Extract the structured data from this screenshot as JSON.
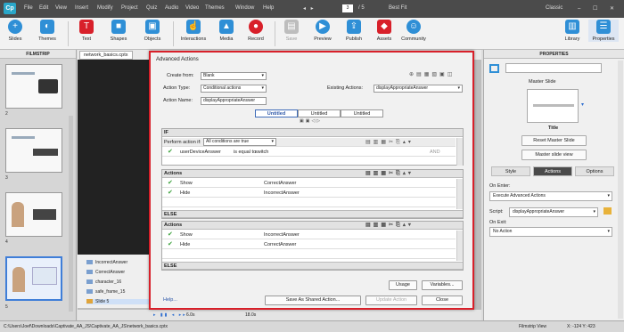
{
  "app": {
    "logo": "Cp",
    "menus": [
      "File",
      "Edit",
      "View",
      "Insert",
      "Modify",
      "Project",
      "Quiz",
      "Audio",
      "Video",
      "Themes",
      "Window",
      "Help"
    ],
    "page_current": "3",
    "page_total": "/ 5",
    "zoom": "Best Fit",
    "workspace": "Classic"
  },
  "toolbar": {
    "items": [
      {
        "label": "Slides",
        "icon": "slides-icon",
        "glyph": "+",
        "color": "#2f8fd6"
      },
      {
        "label": "Themes",
        "icon": "themes-icon",
        "glyph": "◐",
        "color": "#2f8fd6"
      },
      {
        "label": "Text",
        "icon": "text-icon",
        "glyph": "T",
        "color": "#d8202a"
      },
      {
        "label": "Shapes",
        "icon": "shapes-icon",
        "glyph": "■",
        "color": "#2f8fd6"
      },
      {
        "label": "Objects",
        "icon": "objects-icon",
        "glyph": "▣",
        "color": "#2f8fd6"
      },
      {
        "label": "Interactions",
        "icon": "interactions-icon",
        "glyph": "☝",
        "color": "#2f8fd6"
      },
      {
        "label": "Media",
        "icon": "media-icon",
        "glyph": "▲",
        "color": "#2f8fd6"
      },
      {
        "label": "Record",
        "icon": "microphone-icon",
        "glyph": "●",
        "color": "#d8202a"
      },
      {
        "label": "Save",
        "icon": "save-icon",
        "glyph": "▤",
        "color": "#bdbdbd"
      },
      {
        "label": "Preview",
        "icon": "preview-icon",
        "glyph": "▶",
        "color": "#2f8fd6"
      },
      {
        "label": "Publish",
        "icon": "publish-icon",
        "glyph": "⇪",
        "color": "#2f8fd6"
      },
      {
        "label": "Assets",
        "icon": "assets-icon",
        "glyph": "◆",
        "color": "#d8202a"
      },
      {
        "label": "Community",
        "icon": "community-icon",
        "glyph": "☺",
        "color": "#2f8fd6"
      }
    ],
    "right": [
      {
        "label": "Library",
        "icon": "library-icon",
        "glyph": "▥",
        "color": "#2f8fd6"
      },
      {
        "label": "Properties",
        "icon": "properties-icon",
        "glyph": "☰",
        "color": "#2f8fd6"
      }
    ]
  },
  "filmstrip": {
    "title": "FILMSTRIP",
    "slide_numbers": [
      "2",
      "3",
      "4",
      "5"
    ]
  },
  "stage": {
    "tab": "network_basics.cptx"
  },
  "timeline": {
    "rows": [
      "IncorrectAnswer",
      "CorrectAnswer",
      "character_16",
      "safe_frame_15",
      "Slide 5"
    ],
    "time1": "6.0s",
    "time2": "18.0s"
  },
  "dialog": {
    "title": "Advanced Actions",
    "create_from_label": "Create from:",
    "create_from_value": "Blank",
    "action_type_label": "Action Type:",
    "action_type_value": "Conditional actions",
    "existing_label": "Existing Actions:",
    "existing_value": "displayAppropriateAnswer",
    "action_name_label": "Action Name:",
    "action_name_value": "displayAppropriateAnswer",
    "tabs": [
      "Untitled",
      "Untitled",
      "Untitled"
    ],
    "if_label": "IF",
    "perform_label": "Perform action if:",
    "perform_value": "All conditions are true",
    "condition": {
      "var": "userDeviceAnswer",
      "op": "is equal to",
      "val": "switch",
      "and": "AND"
    },
    "actions_label": "Actions",
    "if_actions": [
      {
        "action": "Show",
        "target": "CorrectAnswer"
      },
      {
        "action": "Hide",
        "target": "IncorrectAnswer"
      }
    ],
    "else_label": "ELSE",
    "else_actions": [
      {
        "action": "Show",
        "target": "IncorrectAnswer"
      },
      {
        "action": "Hide",
        "target": "CorrectAnswer"
      }
    ],
    "usage": "Usage",
    "variables": "Variables...",
    "help": "Help...",
    "save_shared": "Save As Shared Action...",
    "update": "Update Action",
    "close": "Close"
  },
  "properties": {
    "title": "PROPERTIES",
    "master_slide": "Master Slide",
    "master_name": "Title",
    "reset_master": "Reset Master Slide",
    "master_view": "Master slide view",
    "tabs": [
      "Style",
      "Actions",
      "Options"
    ],
    "on_enter_label": "On Enter:",
    "on_enter_value": "Execute Advanced Actions",
    "script_label": "Script:",
    "script_value": "displayAppropriateAnswer",
    "on_exit_label": "On Exit:",
    "on_exit_value": "No Action"
  },
  "status": {
    "path": "C:\\Users\\Joef\\Downloads\\Captivate_AA_JS\\Captivate_AA_JS\\network_basics.cptx",
    "view": "Filmstrip View",
    "coords": "X: -124 Y: 423"
  },
  "colors": {
    "accent": "#2f8fd6",
    "dialog_border": "#d8202a",
    "menubar": "#4b4b4b"
  }
}
